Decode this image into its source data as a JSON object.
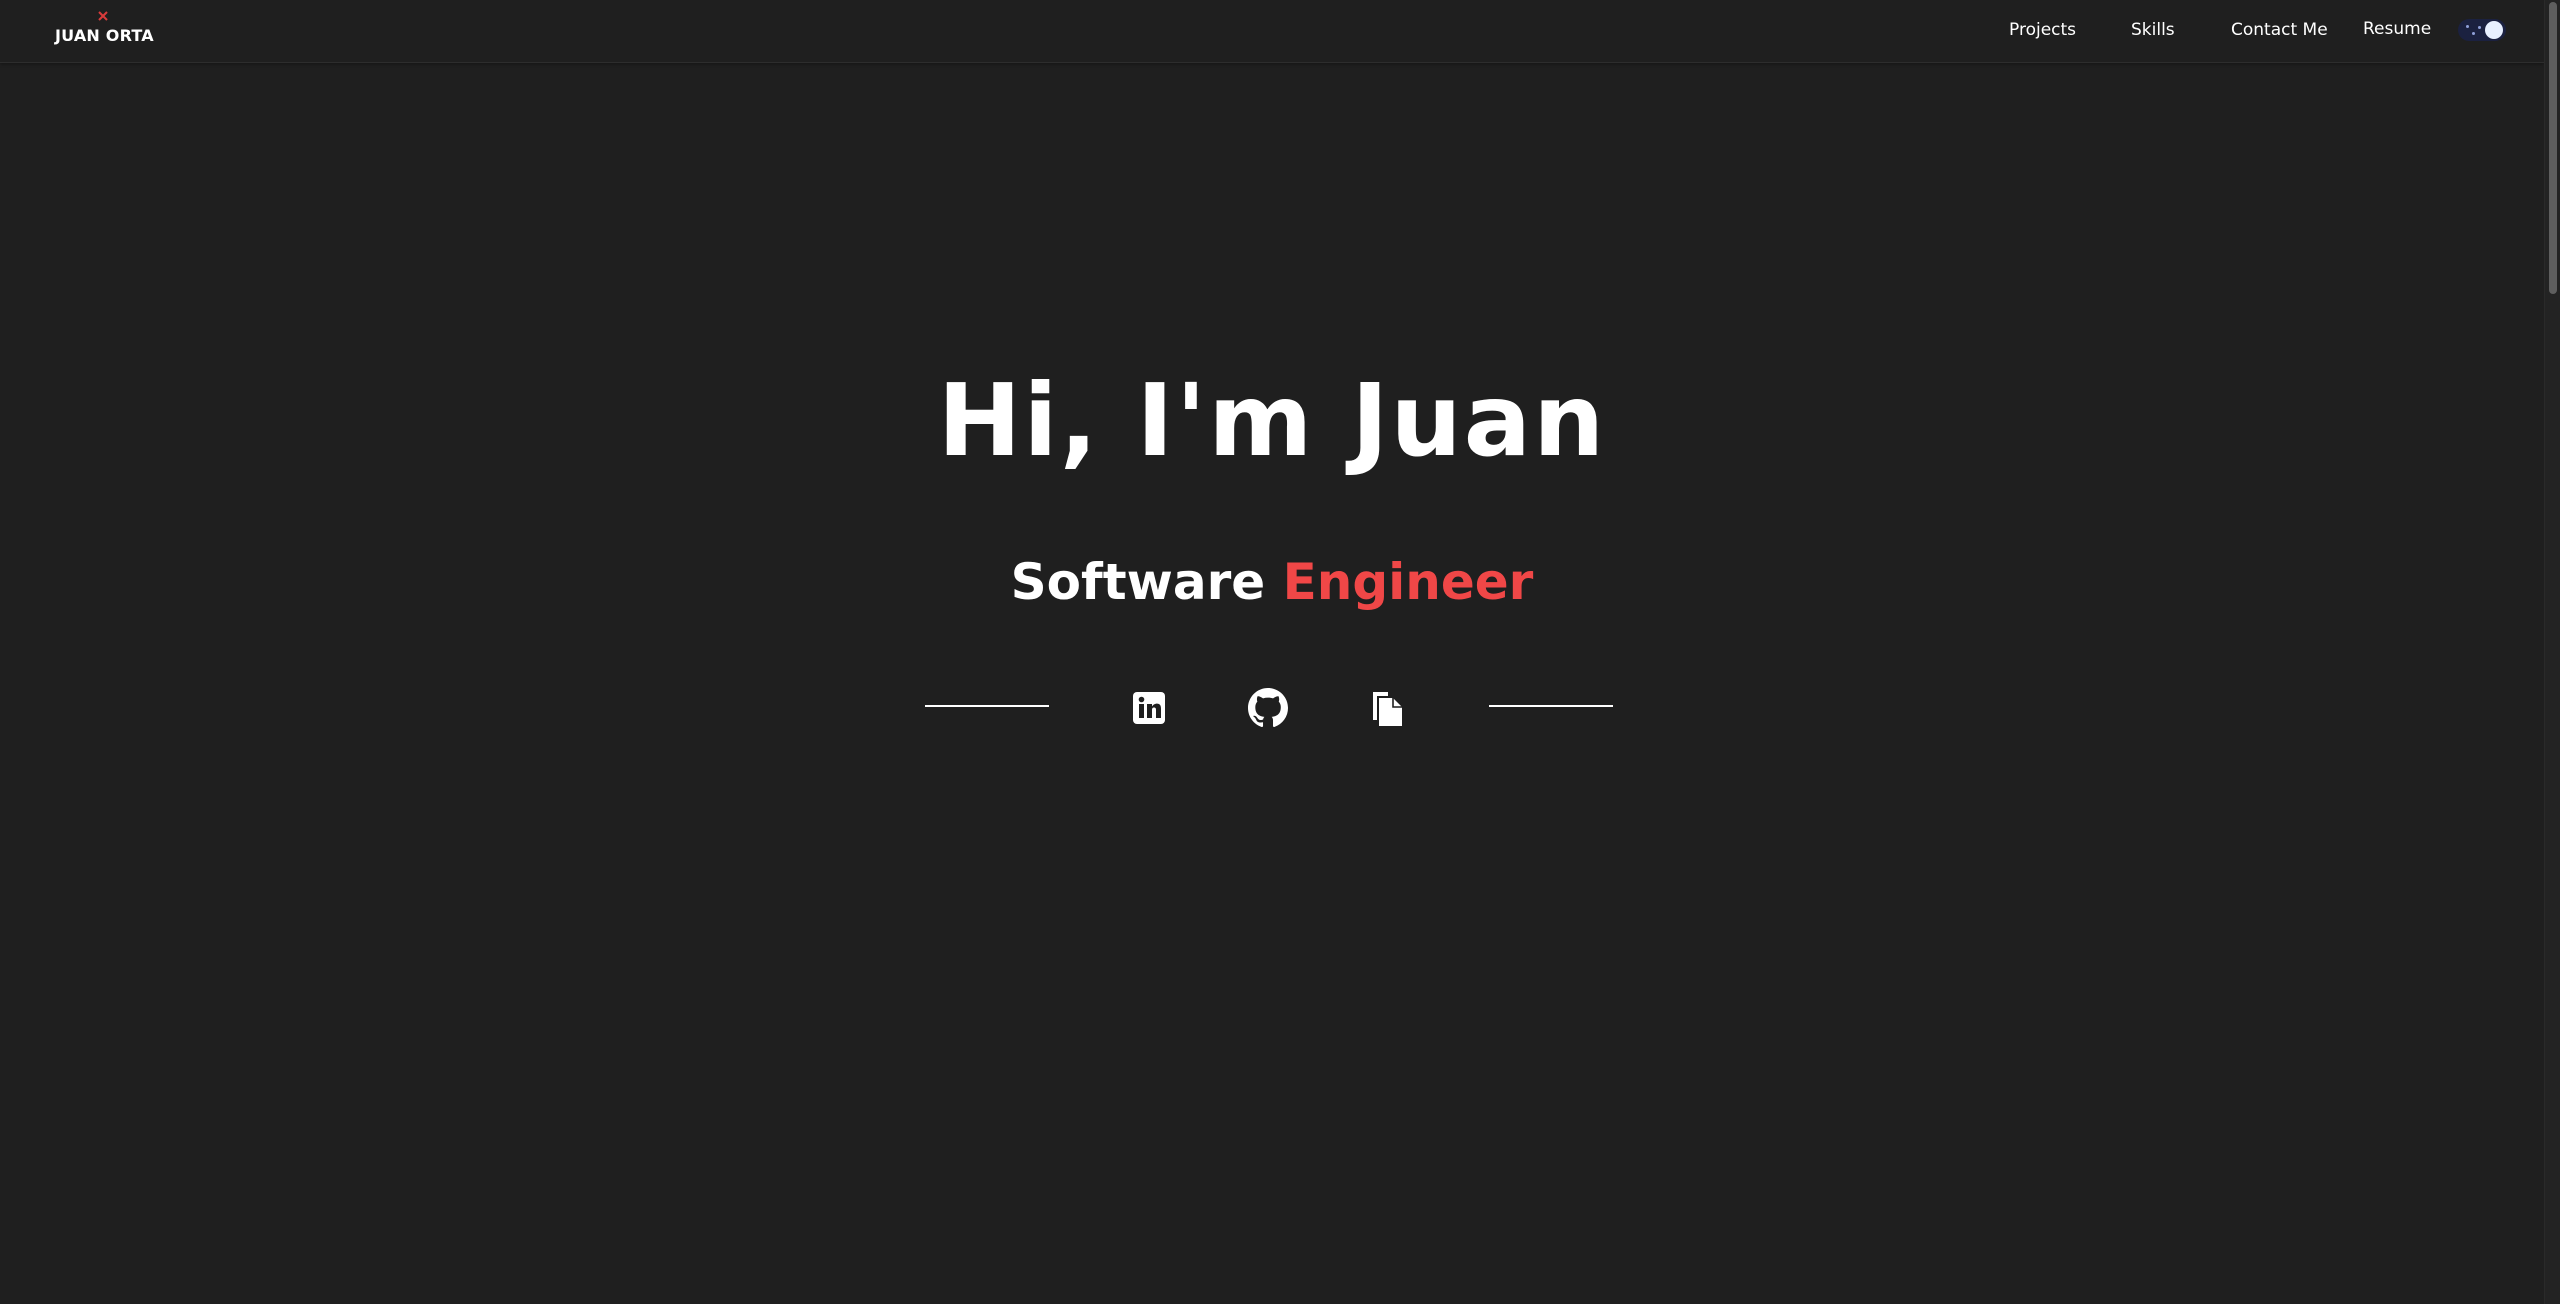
{
  "brand": {
    "name": "JUAN ORTA",
    "accent_color": "#d93b3b"
  },
  "nav": {
    "items": [
      {
        "label": "Projects"
      },
      {
        "label": "Skills"
      },
      {
        "label": "Contact Me"
      },
      {
        "label": "Resume"
      }
    ],
    "theme_toggle": {
      "state": "dark",
      "icon": "moon-stars-icon"
    }
  },
  "hero": {
    "greeting": "Hi, I'm Juan",
    "subtitle_main": "Software ",
    "subtitle_accent": "Engineer",
    "accent_color": "#f04747"
  },
  "social": [
    {
      "name": "LinkedIn",
      "icon": "linkedin-icon"
    },
    {
      "name": "GitHub",
      "icon": "github-icon"
    },
    {
      "name": "Resume",
      "icon": "document-icon"
    }
  ],
  "colors": {
    "background": "#1f1f1f",
    "text": "#ffffff"
  }
}
